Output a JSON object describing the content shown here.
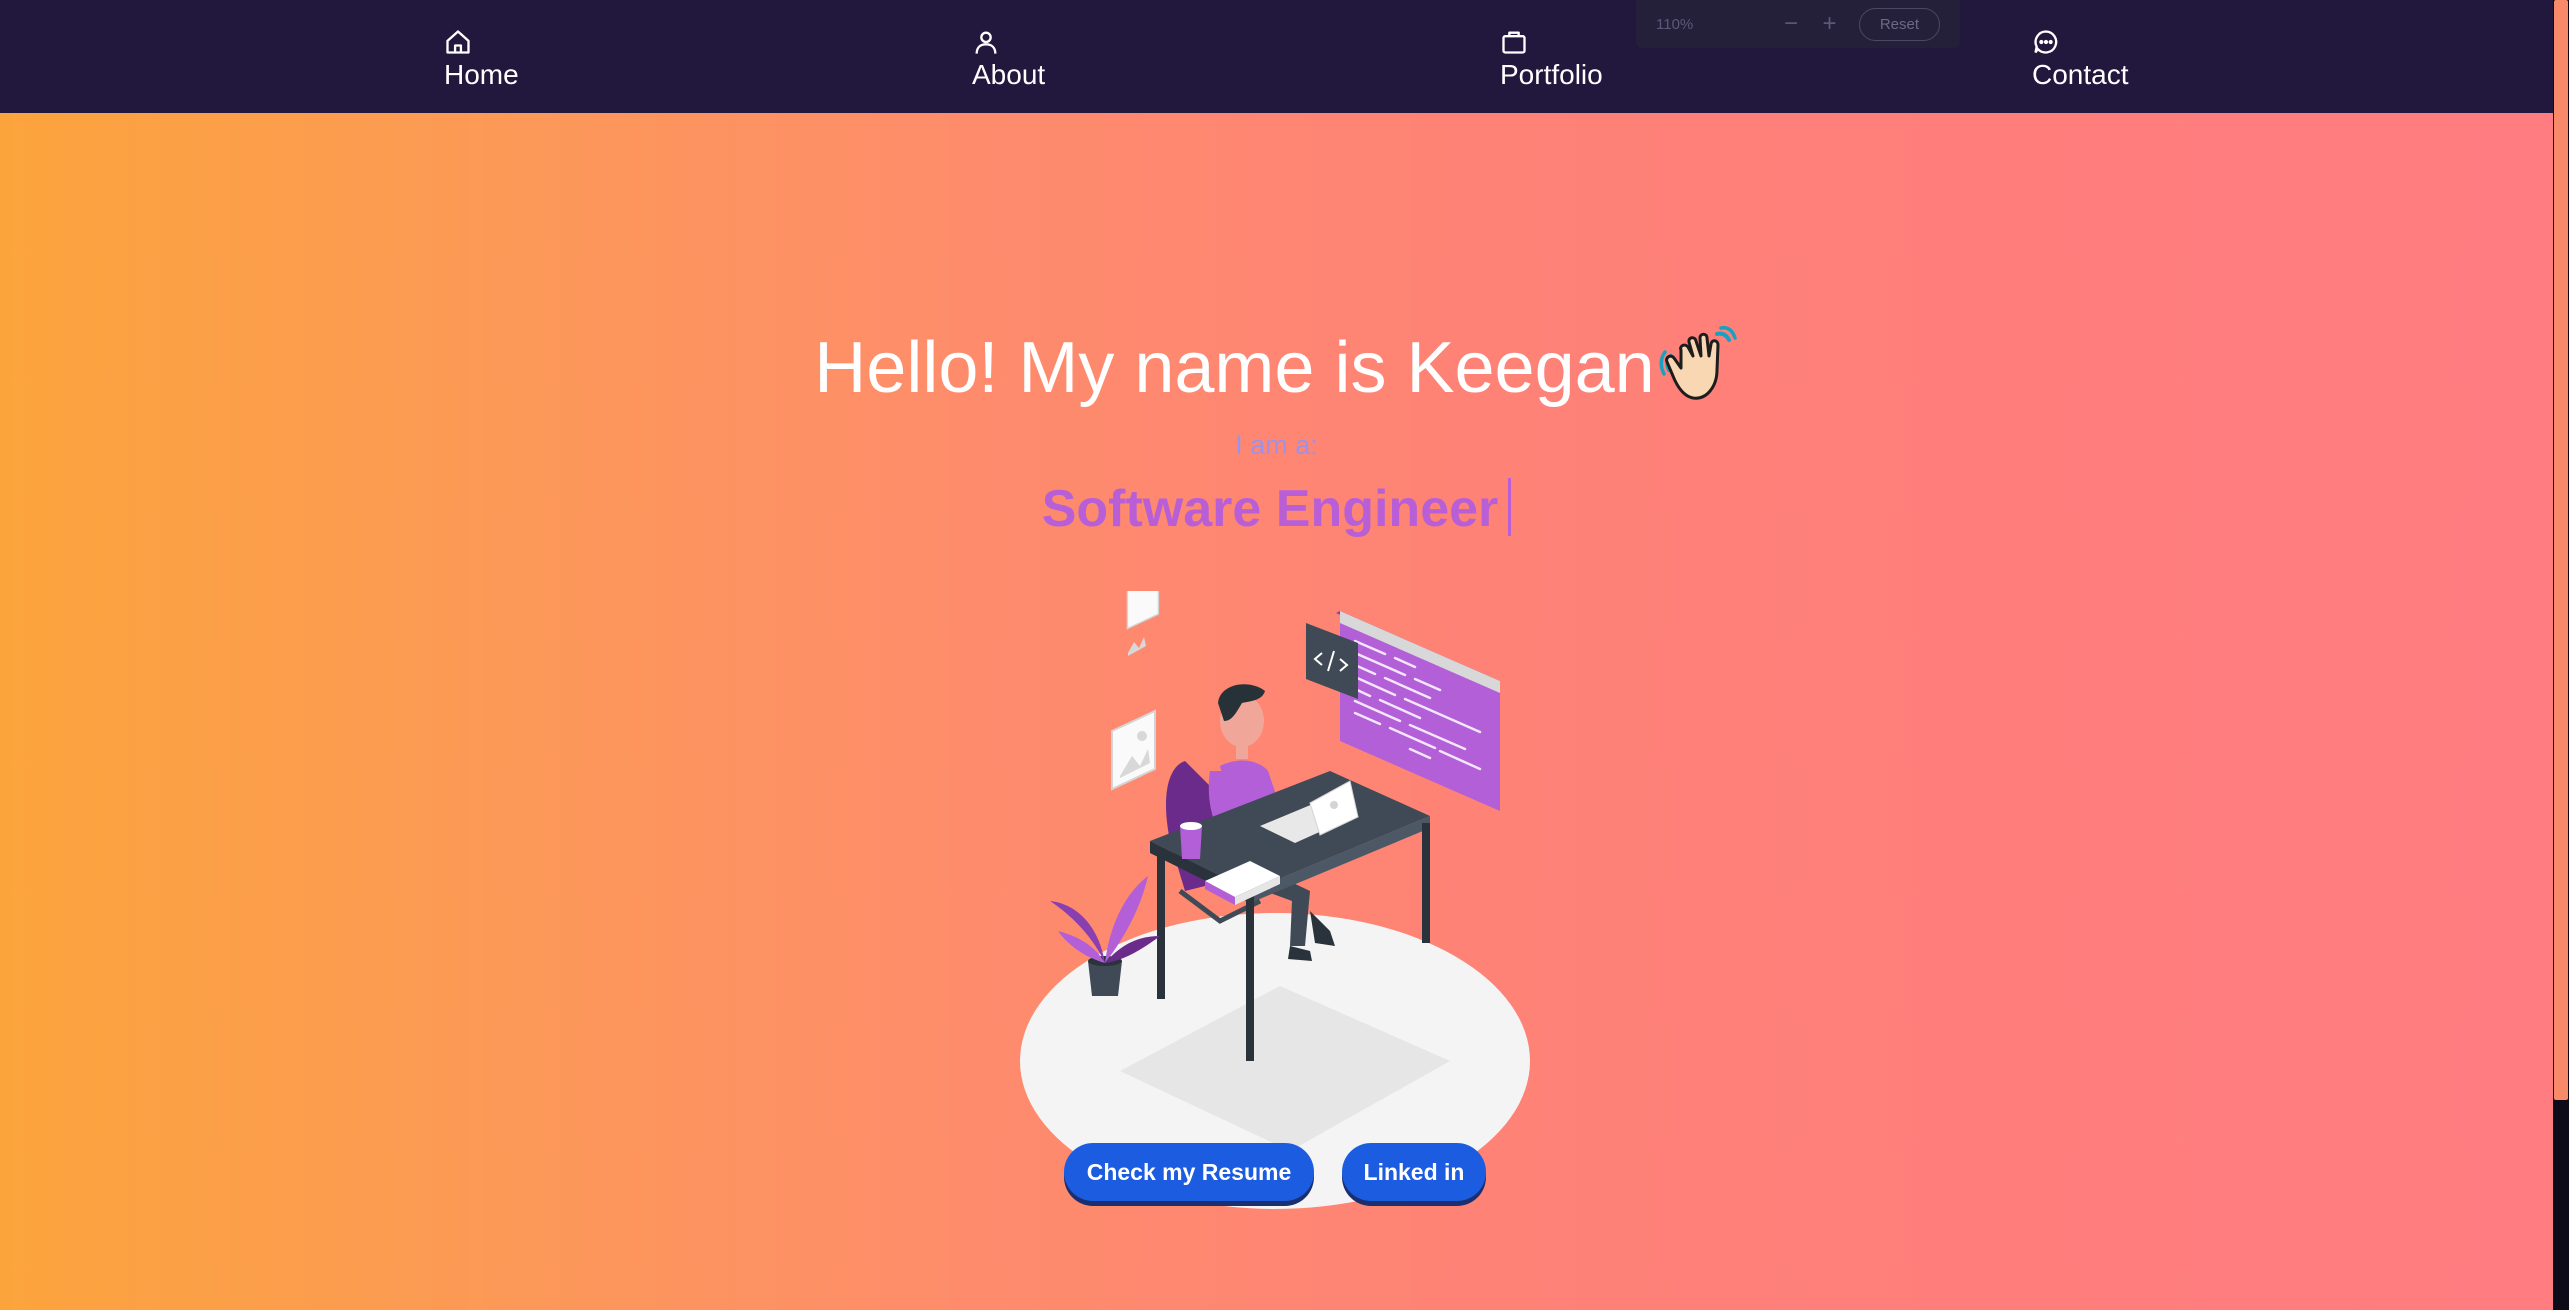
{
  "nav": {
    "items": [
      {
        "label": "Home",
        "icon": "home-icon"
      },
      {
        "label": "About",
        "icon": "user-icon"
      },
      {
        "label": "Portfolio",
        "icon": "briefcase-icon"
      },
      {
        "label": "Contact",
        "icon": "chat-icon"
      }
    ]
  },
  "zoom": {
    "level": "110%",
    "minus": "−",
    "plus": "+",
    "reset_label": "Reset"
  },
  "hero": {
    "greeting": "Hello! My name is Keegan",
    "greeting_emoji": "waving-hand-icon",
    "iama": "I am a:",
    "role": "Software Engineer",
    "illustration": "developer-at-desk-illustration"
  },
  "buttons": {
    "resume": "Check my Resume",
    "linkedin": "Linked in"
  },
  "colors": {
    "nav_bg": "#22173d",
    "gradient_start": "#fca43c",
    "gradient_end": "#ff7c80",
    "role_text": "#b85fd8",
    "iama_text": "#9e92e8",
    "button_bg": "#1c5ce0"
  }
}
